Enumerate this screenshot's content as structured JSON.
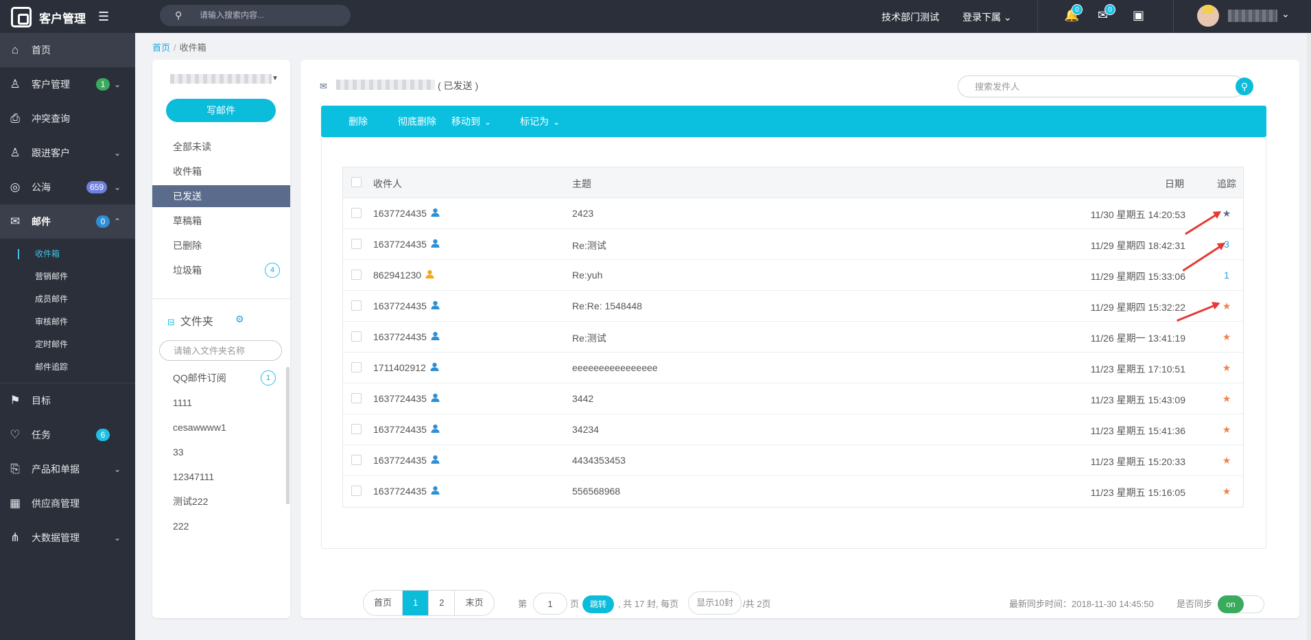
{
  "app": {
    "title": "客户管理"
  },
  "top": {
    "search_placeholder": "请输入搜索内容...",
    "dept": "技术部门测试",
    "login_sub": "登录下属",
    "bell_badge": "0",
    "mail_badge": "0"
  },
  "sidebar": {
    "home": "首页",
    "crm": {
      "label": "客户管理",
      "badge": "1"
    },
    "conflict": "冲突查询",
    "followup": "跟进客户",
    "public": {
      "label": "公海",
      "badge": "659"
    },
    "mail": {
      "label": "邮件",
      "badge": "0"
    },
    "mail_sub": [
      "收件箱",
      "营销邮件",
      "成员邮件",
      "审核邮件",
      "定时邮件",
      "邮件追踪"
    ],
    "goal": "目标",
    "task": {
      "label": "任务",
      "badge": "6"
    },
    "product": "产品和单据",
    "supplier": "供应商管理",
    "bigdata": "大数据管理"
  },
  "breadcrumb": {
    "home": "首页",
    "sep": "/",
    "current": "收件箱"
  },
  "mailpanel": {
    "compose": "写邮件",
    "boxes": [
      {
        "label": "全部未读"
      },
      {
        "label": "收件箱"
      },
      {
        "label": "已发送"
      },
      {
        "label": "草稿箱"
      },
      {
        "label": "已删除"
      },
      {
        "label": "垃圾箱",
        "badge": "4"
      }
    ],
    "folder_title": "文件夹",
    "folder_search_placeholder": "请输入文件夹名称",
    "folders": [
      {
        "label": "QQ邮件订阅",
        "badge": "1"
      },
      {
        "label": "1111"
      },
      {
        "label": "cesawwww1"
      },
      {
        "label": "33"
      },
      {
        "label": "12347111"
      },
      {
        "label": "测试222"
      },
      {
        "label": "222"
      }
    ]
  },
  "main": {
    "sent_label": "( 已发送 )",
    "sender_search_placeholder": "搜索发件人",
    "toolbar": {
      "delete": "删除",
      "purge": "彻底删除",
      "move": "移动到",
      "mark": "标记为"
    },
    "columns": {
      "recipient": "收件人",
      "subject": "主题",
      "date": "日期",
      "track": "追踪"
    },
    "rows": [
      {
        "recipient": "1637724435",
        "person_color": "#2f8fd5",
        "subject": "2423",
        "date": "11/30 星期五 14:20:53",
        "track": "★",
        "track_color": "#5b6b8c"
      },
      {
        "recipient": "1637724435",
        "person_color": "#2f8fd5",
        "subject": "Re:测试",
        "date": "11/29 星期四 18:42:31",
        "track": "3",
        "track_color": "#1aa7d8"
      },
      {
        "recipient": "862941230",
        "person_color": "#f0a91a",
        "subject": "Re:yuh",
        "date": "11/29 星期四 15:33:06",
        "track": "1",
        "track_color": "#1aa7d8"
      },
      {
        "recipient": "1637724435",
        "person_color": "#2f8fd5",
        "subject": "Re:Re: 1548448",
        "date": "11/29 星期四 15:32:22",
        "track": "★",
        "track_color": "#f0824c"
      },
      {
        "recipient": "1637724435",
        "person_color": "#2f8fd5",
        "subject": "Re:测试",
        "date": "11/26 星期一 13:41:19",
        "track": "★",
        "track_color": "#f0824c"
      },
      {
        "recipient": "1711402912",
        "person_color": "#2f8fd5",
        "subject": "eeeeeeeeeeeeeeee",
        "date": "11/23 星期五 17:10:51",
        "track": "★",
        "track_color": "#f0824c"
      },
      {
        "recipient": "1637724435",
        "person_color": "#2f8fd5",
        "subject": "3442",
        "date": "11/23 星期五 15:43:09",
        "track": "★",
        "track_color": "#f0824c"
      },
      {
        "recipient": "1637724435",
        "person_color": "#2f8fd5",
        "subject": "34234",
        "date": "11/23 星期五 15:41:36",
        "track": "★",
        "track_color": "#f0824c"
      },
      {
        "recipient": "1637724435",
        "person_color": "#2f8fd5",
        "subject": "4434353453",
        "date": "11/23 星期五 15:20:33",
        "track": "★",
        "track_color": "#f0824c"
      },
      {
        "recipient": "1637724435",
        "person_color": "#2f8fd5",
        "subject": "556568968",
        "date": "11/23 星期五 15:16:05",
        "track": "★",
        "track_color": "#f0824c"
      }
    ],
    "pager": {
      "first": "首页",
      "p1": "1",
      "p2": "2",
      "last": "末页",
      "page_prefix": "第",
      "page_value": "1",
      "page_suffix": "页",
      "jump": "跳转",
      "summary": ", 共 17 封, 每页",
      "per_page": "显示10封",
      "total_pages": "/共 2页"
    },
    "sync": {
      "time_label": "最新同步时间：2018-11-30 14:45:50",
      "toggle_label": "是否同步",
      "toggle_state": "on"
    }
  }
}
